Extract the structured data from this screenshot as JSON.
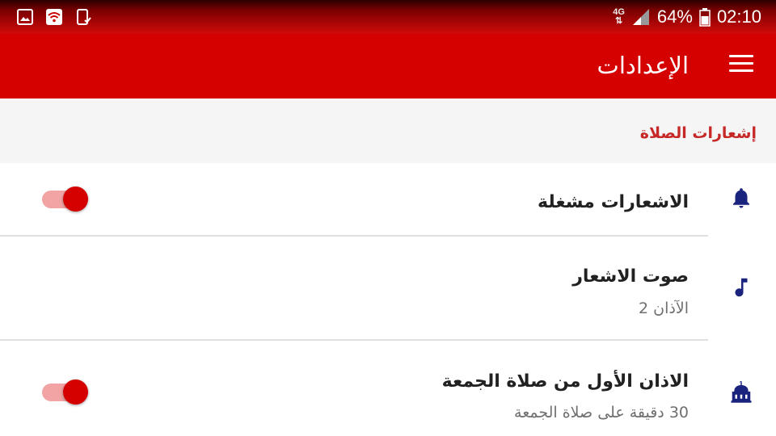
{
  "status_bar": {
    "left_icons": [
      "image-icon",
      "wifi-icon",
      "phone-check-icon"
    ],
    "network": "4G",
    "battery": "64%",
    "time": "02:10"
  },
  "app_bar": {
    "title": "الإعدادات",
    "menu_icon": "hamburger-menu-icon"
  },
  "section": {
    "title": "إشعارات الصلاة"
  },
  "settings": [
    {
      "title": "الاشعارات مشغلة",
      "subtitle": "",
      "icon": "bell-icon",
      "toggle": true
    },
    {
      "title": "صوت الاشعار",
      "subtitle": "الآذان 2",
      "icon": "music-note-icon",
      "toggle": null
    },
    {
      "title": "الاذان الأول من صلاة الجمعة",
      "subtitle": "30 دقيقة على صلاة الجمعة",
      "icon": "mosque-icon",
      "toggle": true
    }
  ],
  "colors": {
    "app_bar": "#d50000",
    "accent": "#c62828",
    "icon": "#1a237e",
    "toggle_thumb": "#d50000",
    "toggle_track": "#f2a3a3"
  }
}
